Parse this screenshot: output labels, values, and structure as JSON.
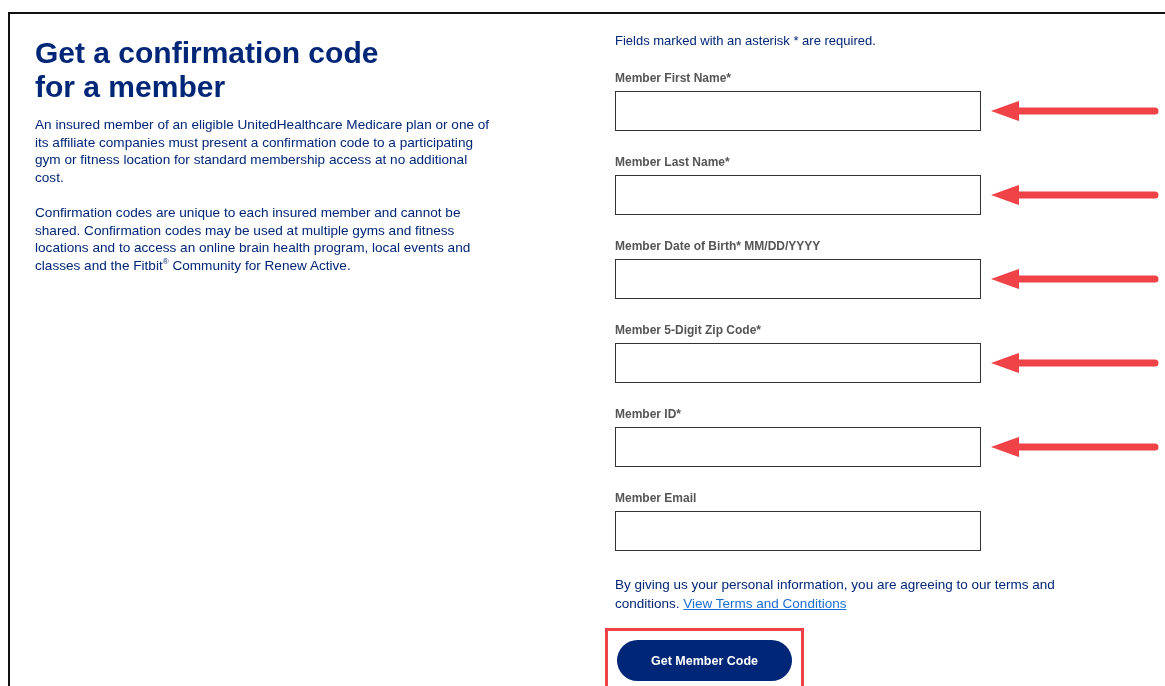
{
  "intro": {
    "title": "Get a confirmation code for a member",
    "paragraphs": [
      "An insured member of an eligible UnitedHealthcare Medicare plan or one of its affiliate companies must present a confirmation code to a participating gym or fitness location for standard membership access at no additional cost.",
      "Confirmation codes are unique to each insured member and cannot be shared. Confirmation codes may be used at multiple gyms and fitness locations and to access an online brain health program, local events and classes and the Fitbit$^{®}$ Community for Renew Active."
    ]
  },
  "form": {
    "note": "Fields marked with an asterisk * are required.",
    "fields": [
      {
        "label": "Member First Name*",
        "marked": true
      },
      {
        "label": "Member Last Name*",
        "marked": true
      },
      {
        "label": "Member Date of Birth* MM/DD/YYYY",
        "marked": true
      },
      {
        "label": "Member 5-Digit Zip Code*",
        "marked": true
      },
      {
        "label": "Member ID*",
        "marked": true
      },
      {
        "label": "Member Email",
        "marked": false
      }
    ],
    "legal": "By giving us your personal information, you are agreeing to our terms and conditions.",
    "legal_link": "View Terms and Conditions",
    "submit": {
      "label": "Get Member Code",
      "highlighted": true
    }
  }
}
